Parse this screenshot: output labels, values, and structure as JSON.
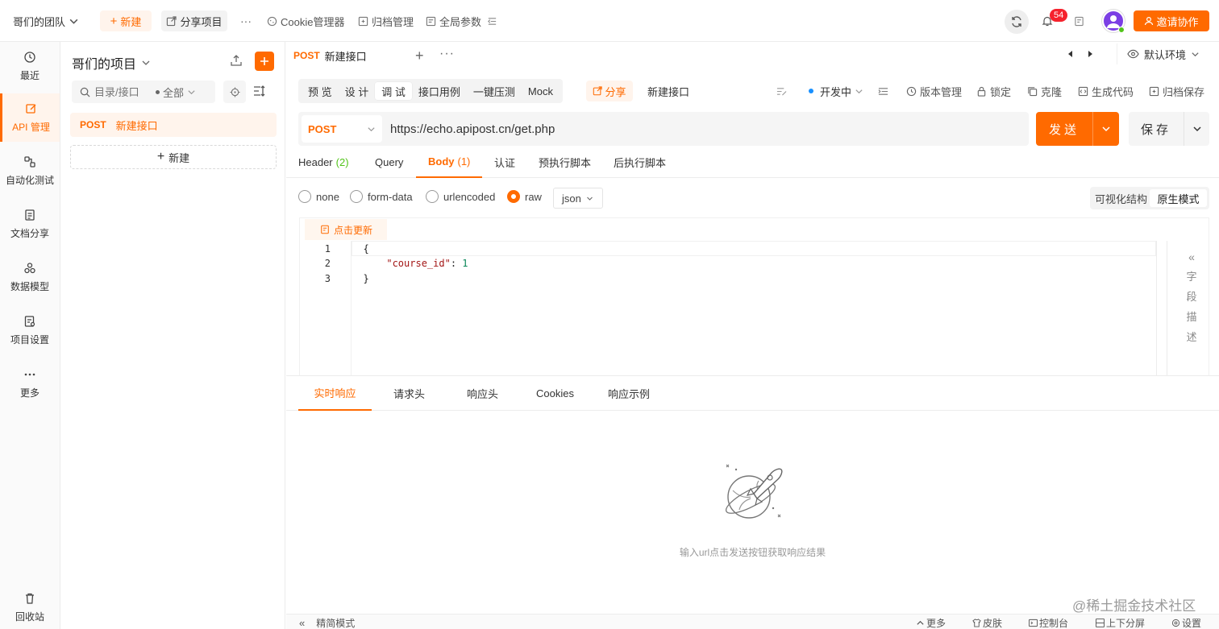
{
  "topbar": {
    "team": "哥们的团队",
    "new_label": "新建",
    "share_project": "分享项目",
    "more": "···",
    "cookie_manager": "Cookie管理器",
    "archive_manager": "归档管理",
    "global_params": "全局参数",
    "notifications": "54",
    "invite": "邀请协作"
  },
  "nav": {
    "recent": "最近",
    "api": "API 管理",
    "autotest": "自动化测试",
    "docs": "文档分享",
    "models": "数据模型",
    "settings": "项目设置",
    "more": "更多",
    "trash": "回收站"
  },
  "project": {
    "title": "哥们的项目",
    "search_placeholder": "目录/接口",
    "filter": "全部",
    "items": [
      {
        "method": "POST",
        "name": "新建接口"
      }
    ],
    "add_label": "新建"
  },
  "tab": {
    "method": "POST",
    "name": "新建接口",
    "environment": "默认环境"
  },
  "toolbar": {
    "modes": [
      "预 览",
      "设 计",
      "调 试",
      "接口用例",
      "一键压测",
      "Mock"
    ],
    "active_mode": "调 试",
    "share": "分享",
    "api_name": "新建接口",
    "status": "开发中",
    "version": "版本管理",
    "lock": "锁定",
    "clone": "克隆",
    "gen_code": "生成代码",
    "archive_save": "归档保存"
  },
  "request": {
    "method": "POST",
    "url": "https://echo.apipost.cn/get.php",
    "send": "发送",
    "save": "保存"
  },
  "req_tabs": {
    "header": "Header",
    "header_count": "(2)",
    "query": "Query",
    "body": "Body",
    "body_count": "(1)",
    "auth": "认证",
    "pre_script": "预执行脚本",
    "post_script": "后执行脚本"
  },
  "body": {
    "options": [
      "none",
      "form-data",
      "urlencoded",
      "raw"
    ],
    "selected": "raw",
    "format": "json",
    "view_visual": "可视化结构",
    "view_raw": "原生模式",
    "refresh": "点击更新",
    "lines": [
      "1",
      "2",
      "3"
    ],
    "code_open": "{",
    "code_key": "\"course_id\"",
    "code_colon": ": ",
    "code_value": "1",
    "code_close": "}",
    "field_desc": [
      "字",
      "段",
      "描",
      "述"
    ]
  },
  "response": {
    "tabs": [
      "实时响应",
      "请求头",
      "响应头",
      "Cookies",
      "响应示例"
    ],
    "empty_text": "输入url点击发送按钮获取响应结果"
  },
  "statusbar": {
    "compact": "精简模式",
    "more": "更多",
    "skin": "皮肤",
    "console": "控制台",
    "split": "上下分屏",
    "settings": "设置"
  },
  "watermark": "@稀土掘金技术社区",
  "colors": {
    "accent": "#ff6a00",
    "accent_light": "#fff4ec",
    "badge": "#f5222d",
    "avatar": "#7b3fe4"
  }
}
